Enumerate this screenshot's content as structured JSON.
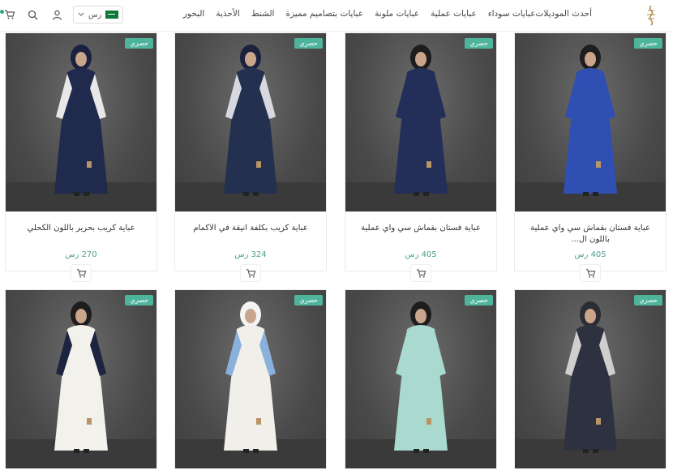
{
  "header": {
    "nav": [
      "أحدث الموديلات",
      "عبايات سوداء",
      "عبايات عملية",
      "عبايات ملونة",
      "عبايات بتصاميم مميزة",
      "الشنط",
      "الأحذية",
      "البخور"
    ],
    "currency": "رس",
    "flag_icon": "saudi-flag-icon"
  },
  "badge_label": "حصري",
  "products_row1": [
    {
      "title": "عباية فستان بقماش سي واي عملية باللون ال...",
      "price": "405 رس",
      "dress": "#2f4fb3",
      "accent": "#2f4fb3",
      "hijab": "#1e1e1e"
    },
    {
      "title": "عباية فستان بقماش سي واي عملية",
      "price": "405 رس",
      "dress": "#232f58",
      "accent": "#232f58",
      "hijab": "#1d1d1d"
    },
    {
      "title": "عباية كريب بكلفة انيقة في الاكمام",
      "price": "324 رس",
      "dress": "#24304f",
      "accent": "#d8d8e0",
      "hijab": "#1b2240"
    },
    {
      "title": "عباية كريب بحرير باللون الكحلي",
      "price": "270 رس",
      "dress": "#1f2a4d",
      "accent": "#e8e8e8",
      "hijab": "#1b2240"
    }
  ],
  "products_row2": [
    {
      "dress": "#2e3140",
      "accent": "#cfcfcf",
      "hijab": "#2c2c34"
    },
    {
      "dress": "#a9d9cf",
      "accent": "#a9d9cf",
      "hijab": "#1d1d1d"
    },
    {
      "dress": "#f1efe9",
      "accent": "#8ab0dc",
      "hijab": "#f4f4f4"
    },
    {
      "dress": "#f3f1ec",
      "accent": "#1c2440",
      "hijab": "#1d1d1d"
    }
  ],
  "colors": {
    "accent": "#4fb49c",
    "price": "#4a9f8c"
  }
}
